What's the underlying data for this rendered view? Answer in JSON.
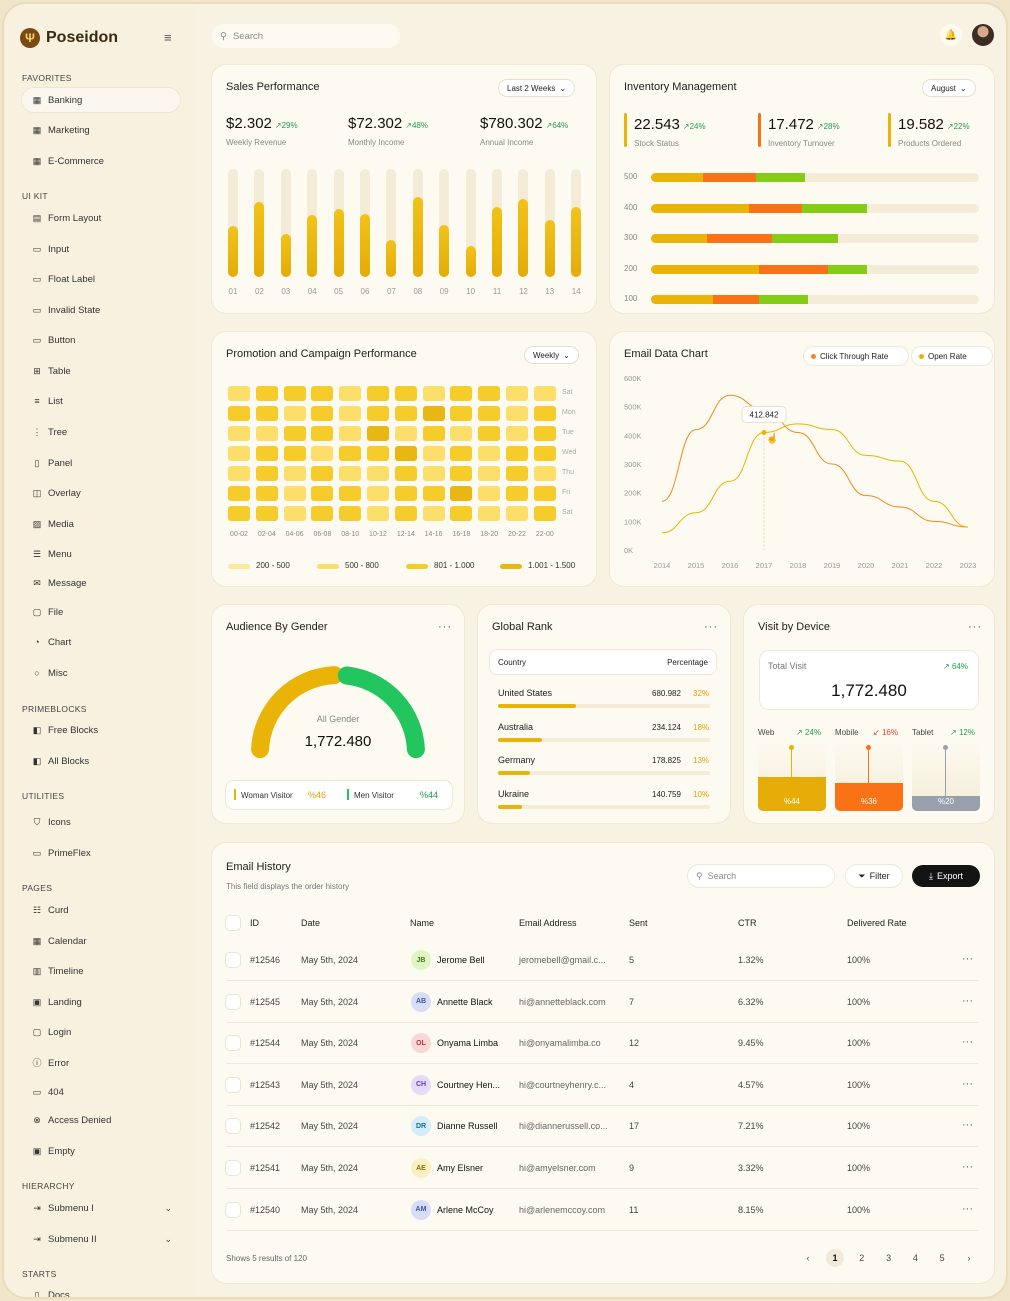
{
  "app": {
    "name": "Poseidon"
  },
  "sidebar": {
    "sections": [
      "FAVORITES",
      "UI KIT",
      "PRIMEBLOCKS",
      "UTILITIES",
      "PAGES",
      "HIERARCHY",
      "STARTS"
    ],
    "items": [
      {
        "label": "Banking",
        "icon": "grid"
      },
      {
        "label": "Marketing",
        "icon": "grid"
      },
      {
        "label": "E-Commerce",
        "icon": "grid"
      },
      {
        "label": "Form Layout",
        "icon": "form"
      },
      {
        "label": "Input",
        "icon": "input"
      },
      {
        "label": "Float Label",
        "icon": "label"
      },
      {
        "label": "Invalid State",
        "icon": "invalid"
      },
      {
        "label": "Button",
        "icon": "button"
      },
      {
        "label": "Table",
        "icon": "table"
      },
      {
        "label": "List",
        "icon": "list"
      },
      {
        "label": "Tree",
        "icon": "tree"
      },
      {
        "label": "Panel",
        "icon": "panel"
      },
      {
        "label": "Overlay",
        "icon": "overlay"
      },
      {
        "label": "Media",
        "icon": "image"
      },
      {
        "label": "Menu",
        "icon": "menu"
      },
      {
        "label": "Message",
        "icon": "message"
      },
      {
        "label": "File",
        "icon": "file"
      },
      {
        "label": "Chart",
        "icon": "chart"
      },
      {
        "label": "Misc",
        "icon": "circle"
      },
      {
        "label": "Free Blocks",
        "icon": "blocks"
      },
      {
        "label": "All Blocks",
        "icon": "blocks"
      },
      {
        "label": "Icons",
        "icon": "shield"
      },
      {
        "label": "PrimeFlex",
        "icon": "desktop"
      },
      {
        "label": "Curd",
        "icon": "curd"
      },
      {
        "label": "Calendar",
        "icon": "calendar"
      },
      {
        "label": "Timeline",
        "icon": "timeline"
      },
      {
        "label": "Landing",
        "icon": "landing"
      },
      {
        "label": "Login",
        "icon": "login"
      },
      {
        "label": "Error",
        "icon": "error"
      },
      {
        "label": "404",
        "icon": "404"
      },
      {
        "label": "Access Denied",
        "icon": "denied"
      },
      {
        "label": "Empty",
        "icon": "empty"
      },
      {
        "label": "Submenu I",
        "icon": "sign-in"
      },
      {
        "label": "Submenu II",
        "icon": "sign-in"
      },
      {
        "label": "Docs",
        "icon": "docs"
      }
    ]
  },
  "topbar": {
    "search_placeholder": "Search"
  },
  "sales": {
    "title": "Sales Performance",
    "dropdown": "Last 2 Weeks",
    "kpis": [
      {
        "value": "$2.302",
        "pct": "29%",
        "label": "Weekly Revenue"
      },
      {
        "value": "$72.302",
        "pct": "48%",
        "label": "Monthly Income"
      },
      {
        "value": "$780.302",
        "pct": "64%",
        "label": "Annual Income"
      }
    ],
    "bars": {
      "labels": [
        "01",
        "02",
        "03",
        "04",
        "05",
        "06",
        "07",
        "08",
        "09",
        "10",
        "11",
        "12",
        "13",
        "14"
      ],
      "values": [
        0.47,
        0.69,
        0.4,
        0.57,
        0.63,
        0.58,
        0.34,
        0.74,
        0.48,
        0.29,
        0.65,
        0.72,
        0.53,
        0.65
      ]
    }
  },
  "inventory": {
    "title": "Inventory Management",
    "dropdown": "August",
    "kpis": [
      {
        "value": "22.543",
        "pct": "24%",
        "label": "Stock Status"
      },
      {
        "value": "17.472",
        "pct": "28%",
        "label": "Inventory Turnover"
      },
      {
        "value": "19.582",
        "pct": "22%",
        "label": "Products Ordered"
      }
    ],
    "rows": [
      {
        "label": "500",
        "s": [
          0.16,
          0.16,
          0.15
        ]
      },
      {
        "label": "400",
        "s": [
          0.3,
          0.16,
          0.2
        ]
      },
      {
        "label": "300",
        "s": [
          0.17,
          0.2,
          0.2
        ]
      },
      {
        "label": "200",
        "s": [
          0.33,
          0.21,
          0.12
        ]
      },
      {
        "label": "100",
        "s": [
          0.19,
          0.14,
          0.15
        ]
      }
    ]
  },
  "promo": {
    "title": "Promotion and Campaign Performance",
    "dropdown": "Weekly",
    "rows": [
      "Sat",
      "Mon",
      "Tue",
      "Wed",
      "Thu",
      "Fri",
      "Sat"
    ],
    "cols": [
      "00-02",
      "02-04",
      "04-06",
      "06-08",
      "08-10",
      "10-12",
      "12-14",
      "14-16",
      "16-18",
      "18-20",
      "20-22",
      "22-00"
    ],
    "legend": [
      "200 - 500",
      "500 - 800",
      "801 - 1.000",
      "1.001 - 1.500"
    ],
    "grid": [
      [
        1,
        2,
        2,
        2,
        1,
        2,
        2,
        1,
        2,
        2,
        1,
        1
      ],
      [
        2,
        2,
        1,
        2,
        1,
        2,
        2,
        3,
        2,
        2,
        1,
        2
      ],
      [
        1,
        1,
        2,
        2,
        1,
        3,
        1,
        2,
        1,
        2,
        1,
        2
      ],
      [
        1,
        2,
        2,
        1,
        2,
        2,
        3,
        1,
        2,
        1,
        2,
        2
      ],
      [
        1,
        2,
        1,
        2,
        1,
        1,
        2,
        1,
        2,
        1,
        2,
        1
      ],
      [
        2,
        2,
        1,
        2,
        2,
        1,
        2,
        2,
        3,
        1,
        2,
        2
      ],
      [
        2,
        2,
        1,
        2,
        2,
        1,
        2,
        1,
        2,
        1,
        1,
        2
      ]
    ]
  },
  "email_chart": {
    "title": "Email Data Chart",
    "legend": [
      {
        "name": "Click Through Rate",
        "color": "#f08a1c"
      },
      {
        "name": "Open Rate",
        "color": "#eab308"
      }
    ],
    "tooltip": "412.842"
  },
  "chart_data": {
    "type": "line",
    "x": [
      "2014",
      "2015",
      "2016",
      "2017",
      "2018",
      "2019",
      "2020",
      "2021",
      "2022",
      "2023"
    ],
    "y_ticks": [
      "600K",
      "500K",
      "400K",
      "300K",
      "200K",
      "100K",
      "0K"
    ],
    "series": [
      {
        "name": "Click Through Rate",
        "values": [
          170,
          420,
          540,
          490,
          410,
          300,
          190,
          150,
          100,
          80
        ]
      },
      {
        "name": "Open Rate",
        "values": [
          60,
          130,
          240,
          410,
          440,
          420,
          330,
          310,
          170,
          80
        ]
      }
    ],
    "ylim": [
      0,
      600
    ]
  },
  "gender": {
    "title": "Audience By Gender",
    "center_label": "All Gender",
    "center_value": "1,772.480",
    "woman": {
      "label": "Woman Visitor",
      "pct": "%46",
      "value": 0.46
    },
    "men": {
      "label": "Men Visitor",
      "pct": "%44",
      "value": 0.44
    }
  },
  "rank": {
    "title": "Global Rank",
    "col1": "Country",
    "col2": "Percentage",
    "rows": [
      {
        "country": "United States",
        "value": "680.982",
        "pct": "32%",
        "fill": 0.32
      },
      {
        "country": "Australia",
        "value": "234.124",
        "pct": "18%",
        "fill": 0.18
      },
      {
        "country": "Germany",
        "value": "178.825",
        "pct": "13%",
        "fill": 0.13
      },
      {
        "country": "Ukraine",
        "value": "140.759",
        "pct": "10%",
        "fill": 0.1
      }
    ]
  },
  "device": {
    "title": "Visit by Device",
    "total_label": "Total Visit",
    "total_pct": "64%",
    "total_value": "1,772.480",
    "items": [
      {
        "name": "Web",
        "pct": "24%",
        "trend": "up",
        "share": "%44",
        "fill": 0.44
      },
      {
        "name": "Mobile",
        "pct": "16%",
        "trend": "down",
        "share": "%36",
        "fill": 0.36
      },
      {
        "name": "Tablet",
        "pct": "12%",
        "trend": "up",
        "share": "%20",
        "fill": 0.2
      }
    ]
  },
  "history": {
    "title": "Email History",
    "subtitle": "This field displays the order history",
    "search_placeholder": "Search",
    "filter": "Filter",
    "export": "Export",
    "headers": [
      "ID",
      "Date",
      "Name",
      "Email Address",
      "Sent",
      "CTR",
      "Delivered Rate"
    ],
    "rows": [
      {
        "id": "#12546",
        "date": "May 5th, 2024",
        "initials": "JB",
        "name": "Jerome Bell",
        "email": "jeromebell@gmail.c...",
        "sent": "5",
        "ctr": "1.32%",
        "rate": "100%",
        "color": "#dff5c4",
        "fg": "#4a7a10"
      },
      {
        "id": "#12545",
        "date": "May 5th, 2024",
        "initials": "AB",
        "name": "Annette Black",
        "email": "hi@annetteblack.com",
        "sent": "7",
        "ctr": "6.32%",
        "rate": "100%",
        "color": "#d7ddf7",
        "fg": "#3f52a8"
      },
      {
        "id": "#12544",
        "date": "May 5th, 2024",
        "initials": "OL",
        "name": "Onyama Limba",
        "email": "hi@onyamalimba.co",
        "sent": "12",
        "ctr": "9.45%",
        "rate": "100%",
        "color": "#fad7d7",
        "fg": "#b03a3a"
      },
      {
        "id": "#12543",
        "date": "May 5th, 2024",
        "initials": "CH",
        "name": "Courtney Hen...",
        "email": "hi@courtneyhenry.c...",
        "sent": "4",
        "ctr": "4.57%",
        "rate": "100%",
        "color": "#e5daf7",
        "fg": "#6a3fa8"
      },
      {
        "id": "#12542",
        "date": "May 5th, 2024",
        "initials": "DR",
        "name": "Dianne Russell",
        "email": "hi@diannerussell.co...",
        "sent": "17",
        "ctr": "7.21%",
        "rate": "100%",
        "color": "#d3eefa",
        "fg": "#1f6a92"
      },
      {
        "id": "#12541",
        "date": "May 5th, 2024",
        "initials": "AE",
        "name": "Amy Elsner",
        "email": "hi@amyelsner.com",
        "sent": "9",
        "ctr": "3.32%",
        "rate": "100%",
        "color": "#fbf0c2",
        "fg": "#8a6a00"
      },
      {
        "id": "#12540",
        "date": "May 5th, 2024",
        "initials": "AM",
        "name": "Arlene McCoy",
        "email": "hi@arlenemccoy.com",
        "sent": "11",
        "ctr": "8.15%",
        "rate": "100%",
        "color": "#d7ddf7",
        "fg": "#3f52a8"
      }
    ],
    "footer": "Shows 5 results of 120",
    "pages": [
      "1",
      "2",
      "3",
      "4",
      "5"
    ]
  }
}
